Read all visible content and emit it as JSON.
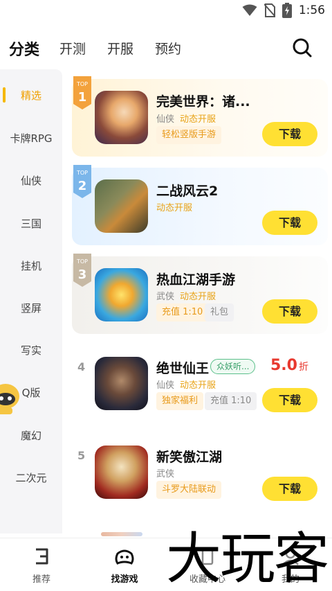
{
  "status_bar": {
    "time": "1:56",
    "icons": [
      "wifi-icon",
      "no-sim-icon",
      "battery-charging-icon"
    ]
  },
  "top_tabs": [
    {
      "label": "分类",
      "active": true
    },
    {
      "label": "开测"
    },
    {
      "label": "开服"
    },
    {
      "label": "预约"
    }
  ],
  "sidebar": {
    "items": [
      {
        "label": "精选",
        "active": true
      },
      {
        "label": "卡牌RPG"
      },
      {
        "label": "仙侠"
      },
      {
        "label": "三国"
      },
      {
        "label": "挂机"
      },
      {
        "label": "竖屏"
      },
      {
        "label": "写实"
      },
      {
        "label": "Q版"
      },
      {
        "label": "魔幻"
      },
      {
        "label": "二次元"
      }
    ]
  },
  "games": [
    {
      "rank": "1",
      "rank_badge": "TOP",
      "title": "完美世界：诸...",
      "genre": "仙侠",
      "dynamic": "动态开服",
      "tags": [
        "轻松竖版手游"
      ],
      "button": "下载"
    },
    {
      "rank": "2",
      "rank_badge": "TOP",
      "title": "二战风云2",
      "genre": "",
      "dynamic": "动态开服",
      "tags": [],
      "button": "下载"
    },
    {
      "rank": "3",
      "rank_badge": "TOP",
      "title": "热血江湖手游",
      "genre": "武侠",
      "dynamic": "动态开服",
      "tags": [
        "充值 1:10",
        "礼包"
      ],
      "button": "下载"
    },
    {
      "rank": "4",
      "title": "绝世仙王",
      "badge": "众妖听...",
      "discount": "5.0",
      "discount_unit": "折",
      "genre": "仙侠",
      "dynamic": "动态开服",
      "tags": [
        "独家福利",
        "充值 1:10"
      ],
      "button": "下载"
    },
    {
      "rank": "5",
      "title": "新笑傲江湖",
      "genre": "武侠",
      "dynamic": "",
      "tags": [
        "斗罗大陆联动"
      ],
      "button": "下载"
    }
  ],
  "bottom_nav": [
    {
      "label": "推荐",
      "icon": "recommend-icon"
    },
    {
      "label": "找游戏",
      "icon": "gamepad-icon",
      "active": true
    },
    {
      "label": "收藏中心",
      "icon": "bookmark-icon"
    },
    {
      "label": "我的",
      "icon": "profile-icon"
    }
  ],
  "watermark": "大玩客",
  "colors": {
    "accent": "#ffe033",
    "active_text": "#f0a000",
    "discount": "#e8392f"
  }
}
